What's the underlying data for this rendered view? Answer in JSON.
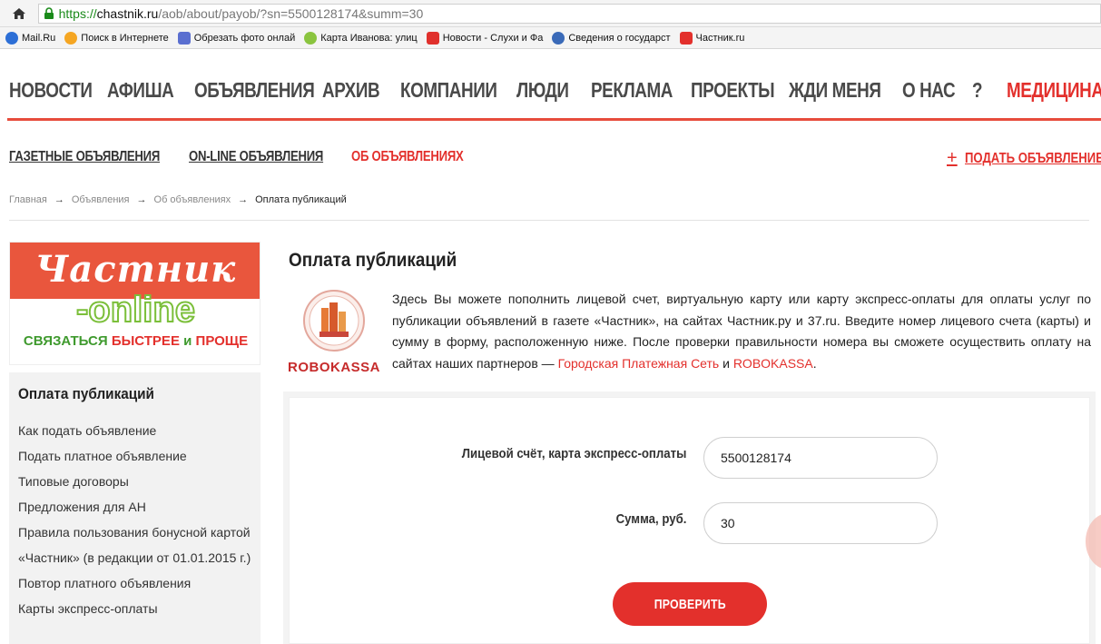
{
  "browser": {
    "url_scheme": "https://",
    "url_host": "chastnik.ru",
    "url_path": "/aob/about/payob/?sn=5500128174&summ=30",
    "bookmarks": [
      {
        "label": "Mail.Ru",
        "color": "#2d6fd6"
      },
      {
        "label": "Поиск в Интернете",
        "color": "#f5a623"
      },
      {
        "label": "Обрезать фото онлай",
        "color": "#5a6fd0"
      },
      {
        "label": "Карта Иванова: улиц",
        "color": "#8ac43f"
      },
      {
        "label": "Новости - Слухи и Фа",
        "color": "#e0302c"
      },
      {
        "label": "Сведения о государст",
        "color": "#3a6ab8"
      },
      {
        "label": "Частник.ru",
        "color": "#e3302c"
      }
    ]
  },
  "nav": {
    "items": [
      "НОВОСТИ",
      "АФИША",
      "ОБЪЯВЛЕНИЯ",
      "АРХИВ",
      "КОМПАНИИ",
      "ЛЮДИ",
      "РЕКЛАМА",
      "ПРОЕКТЫ",
      "ЖДИ МЕНЯ",
      "О НАС",
      "?",
      "МЕДИЦИНА"
    ]
  },
  "subnav": {
    "items": [
      "ГАЗЕТНЫЕ ОБЪЯВЛЕНИЯ",
      "ON-LINE ОБЪЯВЛЕНИЯ",
      "ОБ ОБЪЯВЛЕНИЯХ"
    ],
    "post_ad": "ПОДАТЬ ОБЪЯВЛЕНИЕ"
  },
  "breadcrumb": {
    "items": [
      "Главная",
      "Объявления",
      "Об объявлениях"
    ],
    "current": "Оплата публикаций"
  },
  "banner": {
    "logo": "Частник",
    "online": "-online",
    "tag_1": "СВЯЗАТЬСЯ",
    "tag_2": "БЫСТРЕЕ",
    "tag_3": "и",
    "tag_4": "ПРОЩЕ"
  },
  "sidebar": {
    "title": "Оплата публикаций",
    "links": [
      "Как подать объявление",
      "Подать платное объявление",
      "Типовые договоры",
      "Предложения для АН",
      "Правила пользования бонусной картой «Частник» (в редакции от 01.01.2015 г.)",
      "Повтор платного объявления",
      "Карты экспресс-оплаты"
    ]
  },
  "content": {
    "title": "Оплата публикаций",
    "robokassa": "ROBOKASSA",
    "intro_text": "Здесь Вы можете пополнить лицевой счет, виртуальную карту или карту экспресс-оплаты для оплаты услуг по публикации объявлений в газете «Частник», на сайтах Частник.ру и 37.ru. Введите номер лицевого счета (карты) и сумму в форму, расположенную ниже. После проверки правильности номера вы сможете осуществить оплату на сайтах наших партнеров — ",
    "link_gps": "Городская Платежная Сеть",
    "and": " и ",
    "link_robokassa": "ROBOKASSA",
    "end": "."
  },
  "form": {
    "account_label": "Лицевой счёт, карта экспресс-оплаты",
    "account_value": "5500128174",
    "sum_label": "Сумма, руб.",
    "sum_value": "30",
    "button": "ПРОВЕРИТЬ"
  }
}
